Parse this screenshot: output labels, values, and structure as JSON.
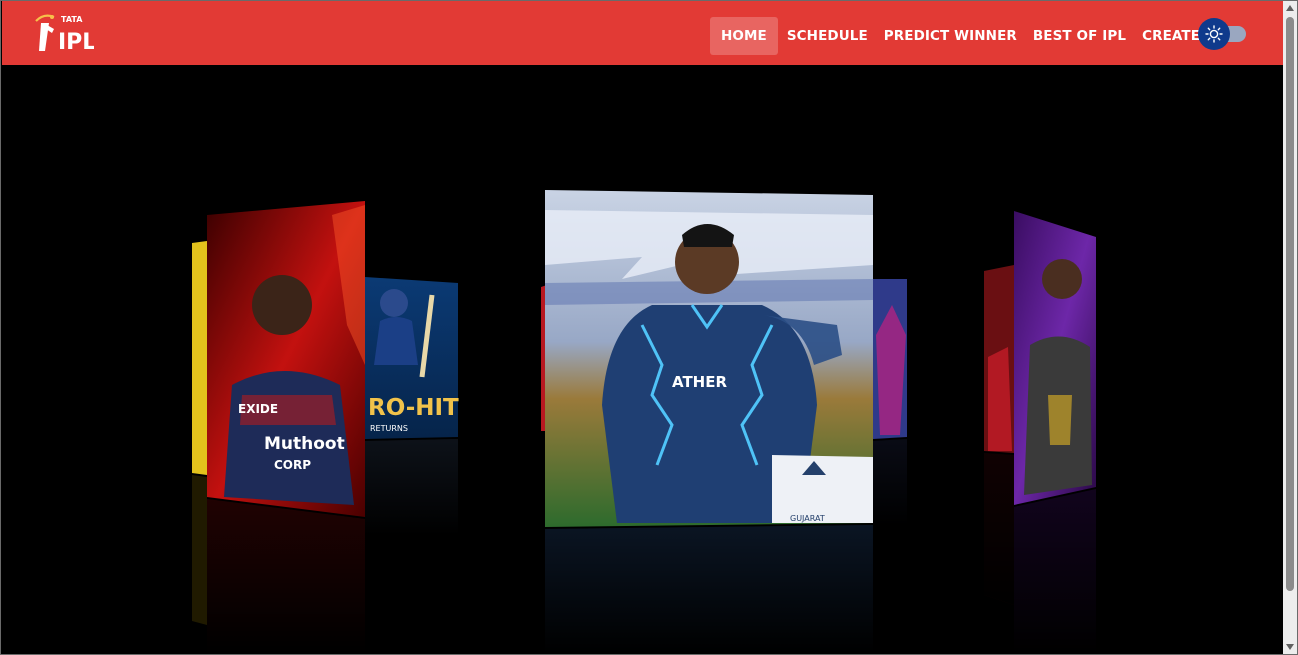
{
  "brand": {
    "logo_top": "TATA",
    "logo_main": "IPL"
  },
  "nav": {
    "items": [
      {
        "label": "HOME",
        "active": true
      },
      {
        "label": "SCHEDULE",
        "active": false
      },
      {
        "label": "PREDICT WINNER",
        "active": false
      },
      {
        "label": "BEST OF IPL",
        "active": false
      },
      {
        "label": "CREATE XI",
        "active": false
      }
    ]
  },
  "theme_toggle": {
    "icon": "sun-icon",
    "state": "light"
  },
  "carousel": {
    "slides": [
      {
        "id": "rcb",
        "sponsor_text": "EXIDE",
        "jersey_text": "Muthoot",
        "jersey_sub": "CORP"
      },
      {
        "id": "mi",
        "poster_text": "RO-HIT",
        "poster_sub": "RETURNS"
      },
      {
        "id": "gt",
        "jersey_text": "ATHER",
        "board_text": "GUJARAT"
      },
      {
        "id": "kkr"
      }
    ]
  },
  "colors": {
    "navbar": "#e23a35",
    "toggle_thumb": "#0f3a8c",
    "toggle_track": "#9aa7c0",
    "background": "#000000"
  }
}
